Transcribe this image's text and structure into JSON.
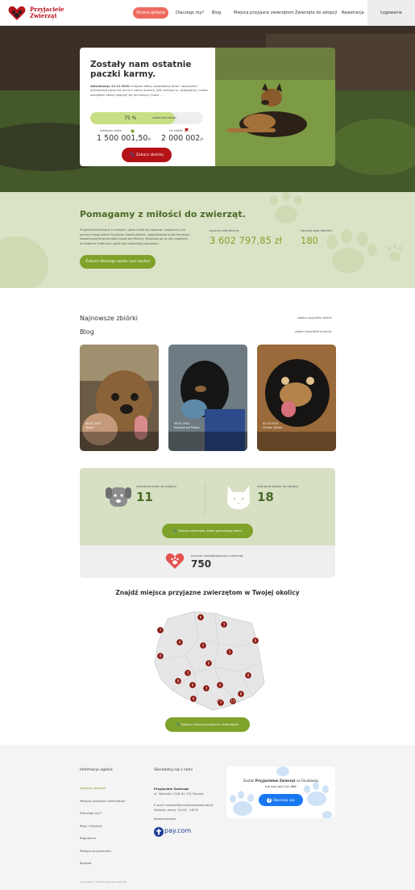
{
  "header": {
    "logo_line1": "Przyjaciele",
    "logo_line2": "Zwierząt",
    "nav": [
      "Strona główna",
      "Dlaczego my?",
      "Blog",
      "Miejsca przyjazne zwierzętom",
      "Zwierzęta do adopcji",
      "Rejestracja"
    ],
    "login": "Logowanie",
    "accent": "#ef6a5e",
    "brand": "#b8121b"
  },
  "hero": {
    "title": "Zostały nam ostatnie paczki karmy.",
    "update_label": "Aktualizacja 13.11.2020:",
    "text": "Krajowe ofiary rozdzielamy teraz i wszystkich Interwencja Łączy się od lat z całym domem. Jeśli szukasz tu, dziękujemy, trzeba wszystkim którzy włączyli się do pomocy. Sunia ...",
    "progress_pct": "75 %",
    "progress_value": 0.75,
    "progress_label": "uzbieranej kwoty!",
    "collected_label": "Uzbierana kwota",
    "collected_value": "1 500 001,50",
    "goal_label": "Cel zbiórki",
    "goal_value": "2 000 002",
    "currency": "zł",
    "cta": "Zobacz zbiórkę"
  },
  "mission": {
    "title": "Pomagamy z miłości do zwierząt.",
    "text": "PrzyjacieleZwierzat.pl to miejsce, gdzie miłośnicy zwierząt i zwolennicy ich pomocy mogą zebrać fundusze. Każda zbiórka, organizowana przez fundacje i stowarzyszenia przechodzi naszą weryfikację. Wszystko po to, aby zapewnić, że wsparcie trafia tam, gdzie jest najbardziej potrzebne.",
    "cta": "Zobacz dlaczego warto nam zaufać",
    "raised_label": "Łącznie zebraliśmy:",
    "raised_value": "3 602 797,85 zł",
    "fundraisers_label": "Łącznie było zbiórek:",
    "fundraisers_value": "180"
  },
  "latest": {
    "title": "Najnowsze zbiórki",
    "see_all": "zobacz wszystkie zbiórki"
  },
  "blog": {
    "title": "Blog",
    "see_all": "zobacz wszystkie artykuły",
    "posts": [
      {
        "date": "06.02.2020",
        "title": "Maluci"
      },
      {
        "date": "09.02.2020",
        "title": "Impreza wd Pieseu"
      },
      {
        "date": "02.03.2019",
        "title": "Citroen Saluto"
      }
    ]
  },
  "counters": {
    "dogs_label": "Aktualnie psów do adopcji",
    "dogs_value": "11",
    "cats_label": "Aktualnie kotów do adopcji",
    "cats_value": "18",
    "cta": "Zobacz zwierzęta, które potrzebują domu",
    "adopted_label": "Łącznie zaadoptowanych zwierząt",
    "adopted_value": "750"
  },
  "map": {
    "title": "Znajdź miejsca przyjazne zwierzętom w Twojej okolicy",
    "cta": "Zobacz miejsca przyjazne zwierzętom",
    "markers": [
      "6",
      "3",
      "7",
      "4",
      "5",
      "6",
      "0",
      "5",
      "0",
      "3",
      "8",
      "8",
      "6",
      "3",
      "6",
      "6",
      "6",
      "6",
      "17",
      "7"
    ]
  },
  "footer": {
    "col1_title": "Informacje ogólne",
    "col1_links": [
      "Adopcja zwierząt",
      "Miejsca przyjazne zwierzętom",
      "Dlaczego my?",
      "Blog / Artykuły",
      "Regulamin",
      "Polityka prywatności",
      "Kontakt"
    ],
    "col2_title": "Skontaktuj się z nami",
    "org_name": "Przyjaciele Zwierząt",
    "address": "ul. Wolności 15/8 61-751 Poznań",
    "email": "E-mail: kontakt@przyjacielezwierzat.pl",
    "hours": "Godziny pracy: 10:00 - 18:00",
    "payments_label": "Bezpieczeństwo",
    "paylogo": "pay.com",
    "fb_text1": "Zostań",
    "fb_text2": "Przyjacielem Zwierząt",
    "fb_text3": "na Facebooku",
    "fb_likes": "Już nas lubi 241 866",
    "fb_button": "Obserwuj nas",
    "copyright": "Copyright © 2019 Przyjaciele Zwierząt"
  }
}
